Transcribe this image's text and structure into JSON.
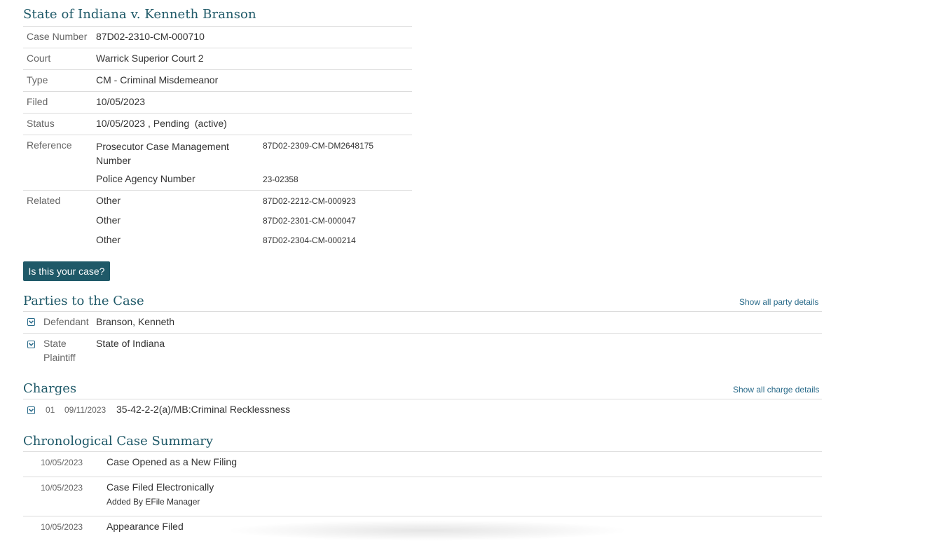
{
  "case": {
    "title": "State of Indiana v. Kenneth Branson",
    "fields": {
      "case_number_label": "Case Number",
      "case_number": "87D02-2310-CM-000710",
      "court_label": "Court",
      "court": "Warrick Superior Court 2",
      "type_label": "Type",
      "type": "CM - Criminal Misdemeanor",
      "filed_label": "Filed",
      "filed": "10/05/2023",
      "status_label": "Status",
      "status": "10/05/2023 , Pending  (active)",
      "reference_label": "Reference",
      "references": [
        {
          "name": "Prosecutor Case Management Number",
          "value": "87D02-2309-CM-DM2648175"
        },
        {
          "name": "Police Agency Number",
          "value": "23-02358"
        }
      ],
      "related_label": "Related",
      "related": [
        {
          "name": "Other",
          "value": "87D02-2212-CM-000923"
        },
        {
          "name": "Other",
          "value": "87D02-2301-CM-000047"
        },
        {
          "name": "Other",
          "value": "87D02-2304-CM-000214"
        }
      ]
    },
    "is_your_case_button": "Is this your case?"
  },
  "parties": {
    "title": "Parties to the Case",
    "show_all_link": "Show all party details",
    "items": [
      {
        "role": "Defendant",
        "name": "Branson, Kenneth"
      },
      {
        "role_line1": "State",
        "role_line2": "Plaintiff",
        "name": "State of Indiana"
      }
    ]
  },
  "charges": {
    "title": "Charges",
    "show_all_link": "Show all charge details",
    "items": [
      {
        "number": "01",
        "date": "09/11/2023",
        "description": "35-42-2-2(a)/MB:Criminal Recklessness"
      }
    ]
  },
  "ccs": {
    "title": "Chronological Case Summary",
    "entries": [
      {
        "date": "10/05/2023",
        "text": "Case Opened as a New Filing",
        "sub": ""
      },
      {
        "date": "10/05/2023",
        "text": "Case Filed Electronically",
        "sub": "Added By EFile Manager"
      },
      {
        "date": "10/05/2023",
        "text": "Appearance Filed",
        "sub": ""
      }
    ]
  },
  "icons": {
    "expander": "expand-chevron-icon"
  },
  "colors": {
    "accent": "#1f5968",
    "link": "#2a6b8a",
    "divider": "#dcdcdc"
  }
}
